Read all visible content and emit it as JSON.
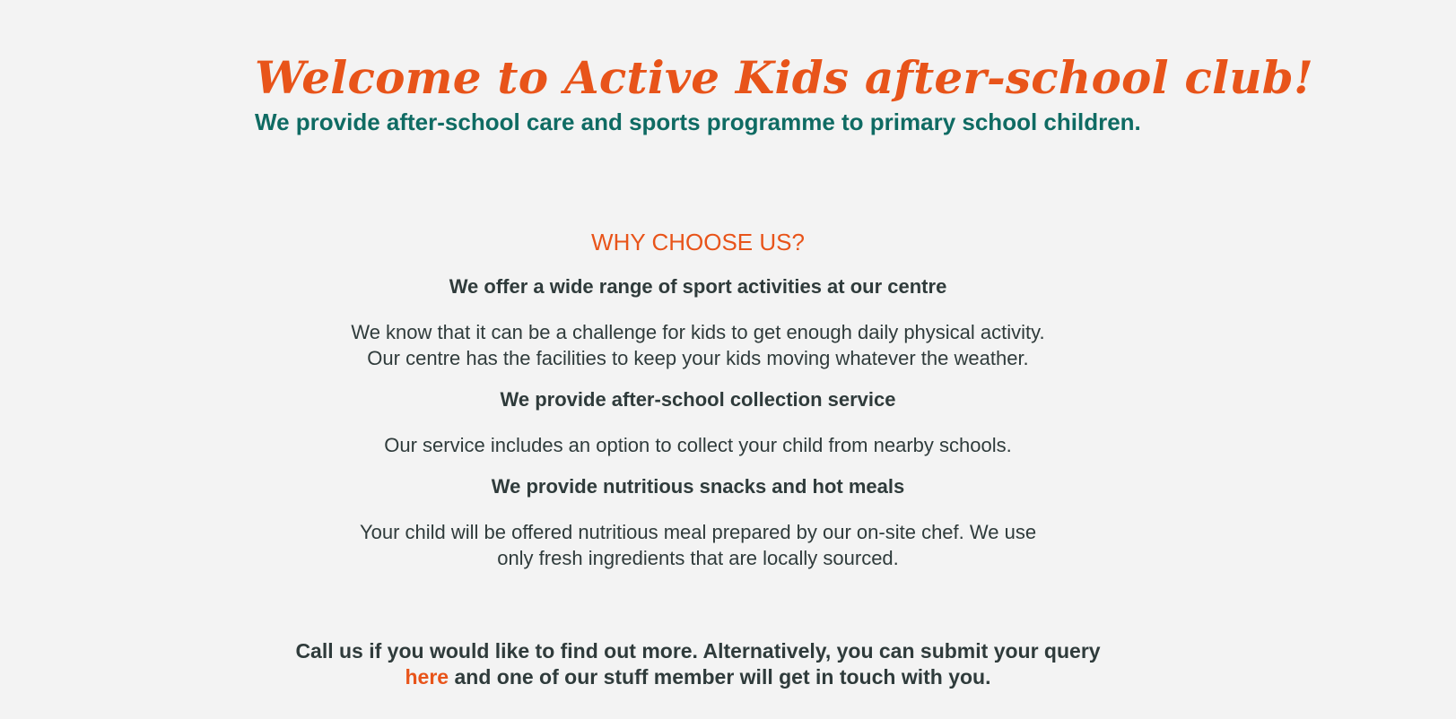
{
  "hero": {
    "title": "Welcome to Active Kids after-school club!",
    "subtitle": "We provide after-school care and sports programme to primary school children."
  },
  "why": {
    "heading": "WHY CHOOSE US?",
    "features": [
      {
        "title": "We offer a wide range of sport activities at our centre",
        "text_lines": [
          "We know that it can be a challenge for kids to get enough daily physical activity.",
          "Our centre has the facilities to keep your kids moving whatever the weather."
        ]
      },
      {
        "title": "We provide after-school collection service",
        "text_lines": [
          "Our service includes an option to collect your child from nearby schools."
        ]
      },
      {
        "title": "We provide nutritious snacks and hot meals",
        "text_lines": [
          "Your child will be offered nutritious meal prepared by our on-site chef. We use",
          "only fresh ingredients that are locally sourced."
        ]
      }
    ]
  },
  "contact": {
    "line1": "Call us if you would like to find out more. Alternatively, you can submit your query",
    "link_label": "here",
    "line2_rest": " and one of our stuff member will get in touch with you."
  },
  "colors": {
    "accent": "#e8541a",
    "teal": "#0f6b63",
    "text": "#2f3b3b",
    "background": "#f3f3f3"
  }
}
